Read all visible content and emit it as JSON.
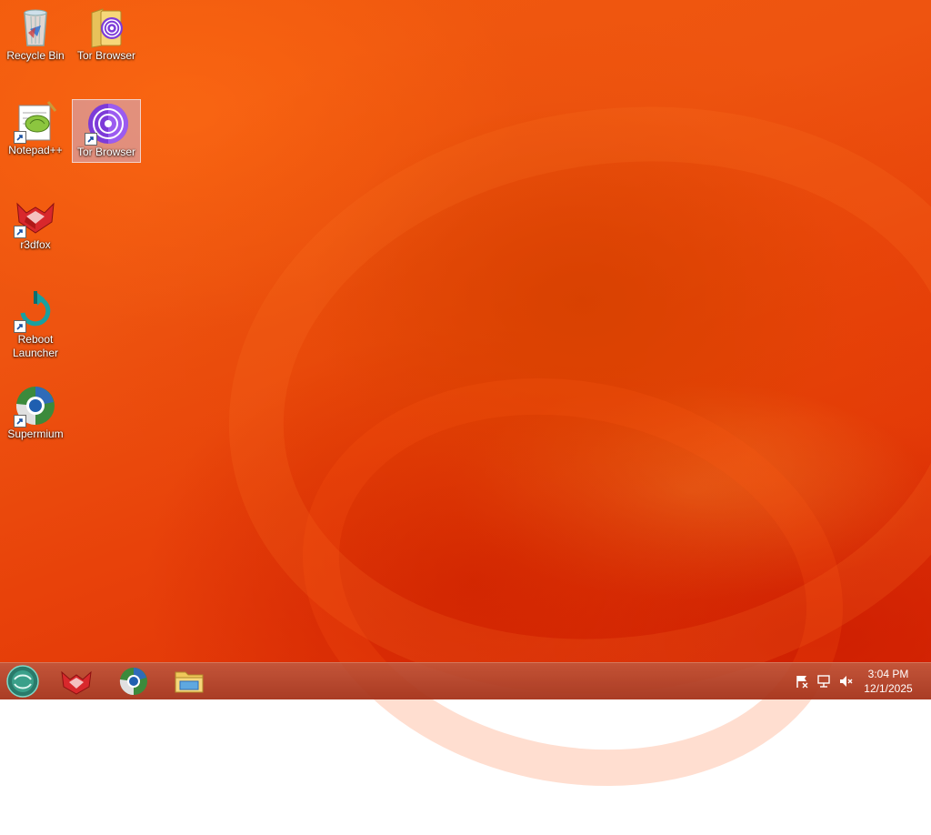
{
  "desktop": {
    "icons": [
      {
        "label": "Recycle Bin",
        "icon": "recycle-bin-icon"
      },
      {
        "label": "Tor Browser",
        "icon": "folder-icon"
      },
      {
        "label": "Notepad++",
        "icon": "notepad-plus-plus-icon"
      },
      {
        "label": "Tor Browser",
        "icon": "tor-browser-icon"
      },
      {
        "label": "r3dfox",
        "icon": "r3dfox-icon"
      },
      {
        "label": "Reboot Launcher",
        "icon": "reboot-launcher-icon"
      },
      {
        "label": "Supermium",
        "icon": "supermium-icon"
      }
    ],
    "selected_icon": "Tor Browser"
  },
  "taskbar": {
    "start_icon": "start-orb-icon",
    "pinned": [
      {
        "icon": "r3dfox-icon"
      },
      {
        "icon": "supermium-icon"
      },
      {
        "icon": "file-explorer-icon"
      }
    ],
    "tray": [
      {
        "icon": "action-center-flag-icon"
      },
      {
        "icon": "network-icon"
      },
      {
        "icon": "volume-muted-icon"
      }
    ],
    "clock": {
      "time": "3:04 PM",
      "date": "12/1/2025"
    }
  },
  "colors": {
    "wallpaper_primary": "#ee5410",
    "wallpaper_dark": "#d42a05",
    "taskbar": "#b4442a",
    "tor_purple": "#7d3bd8"
  }
}
